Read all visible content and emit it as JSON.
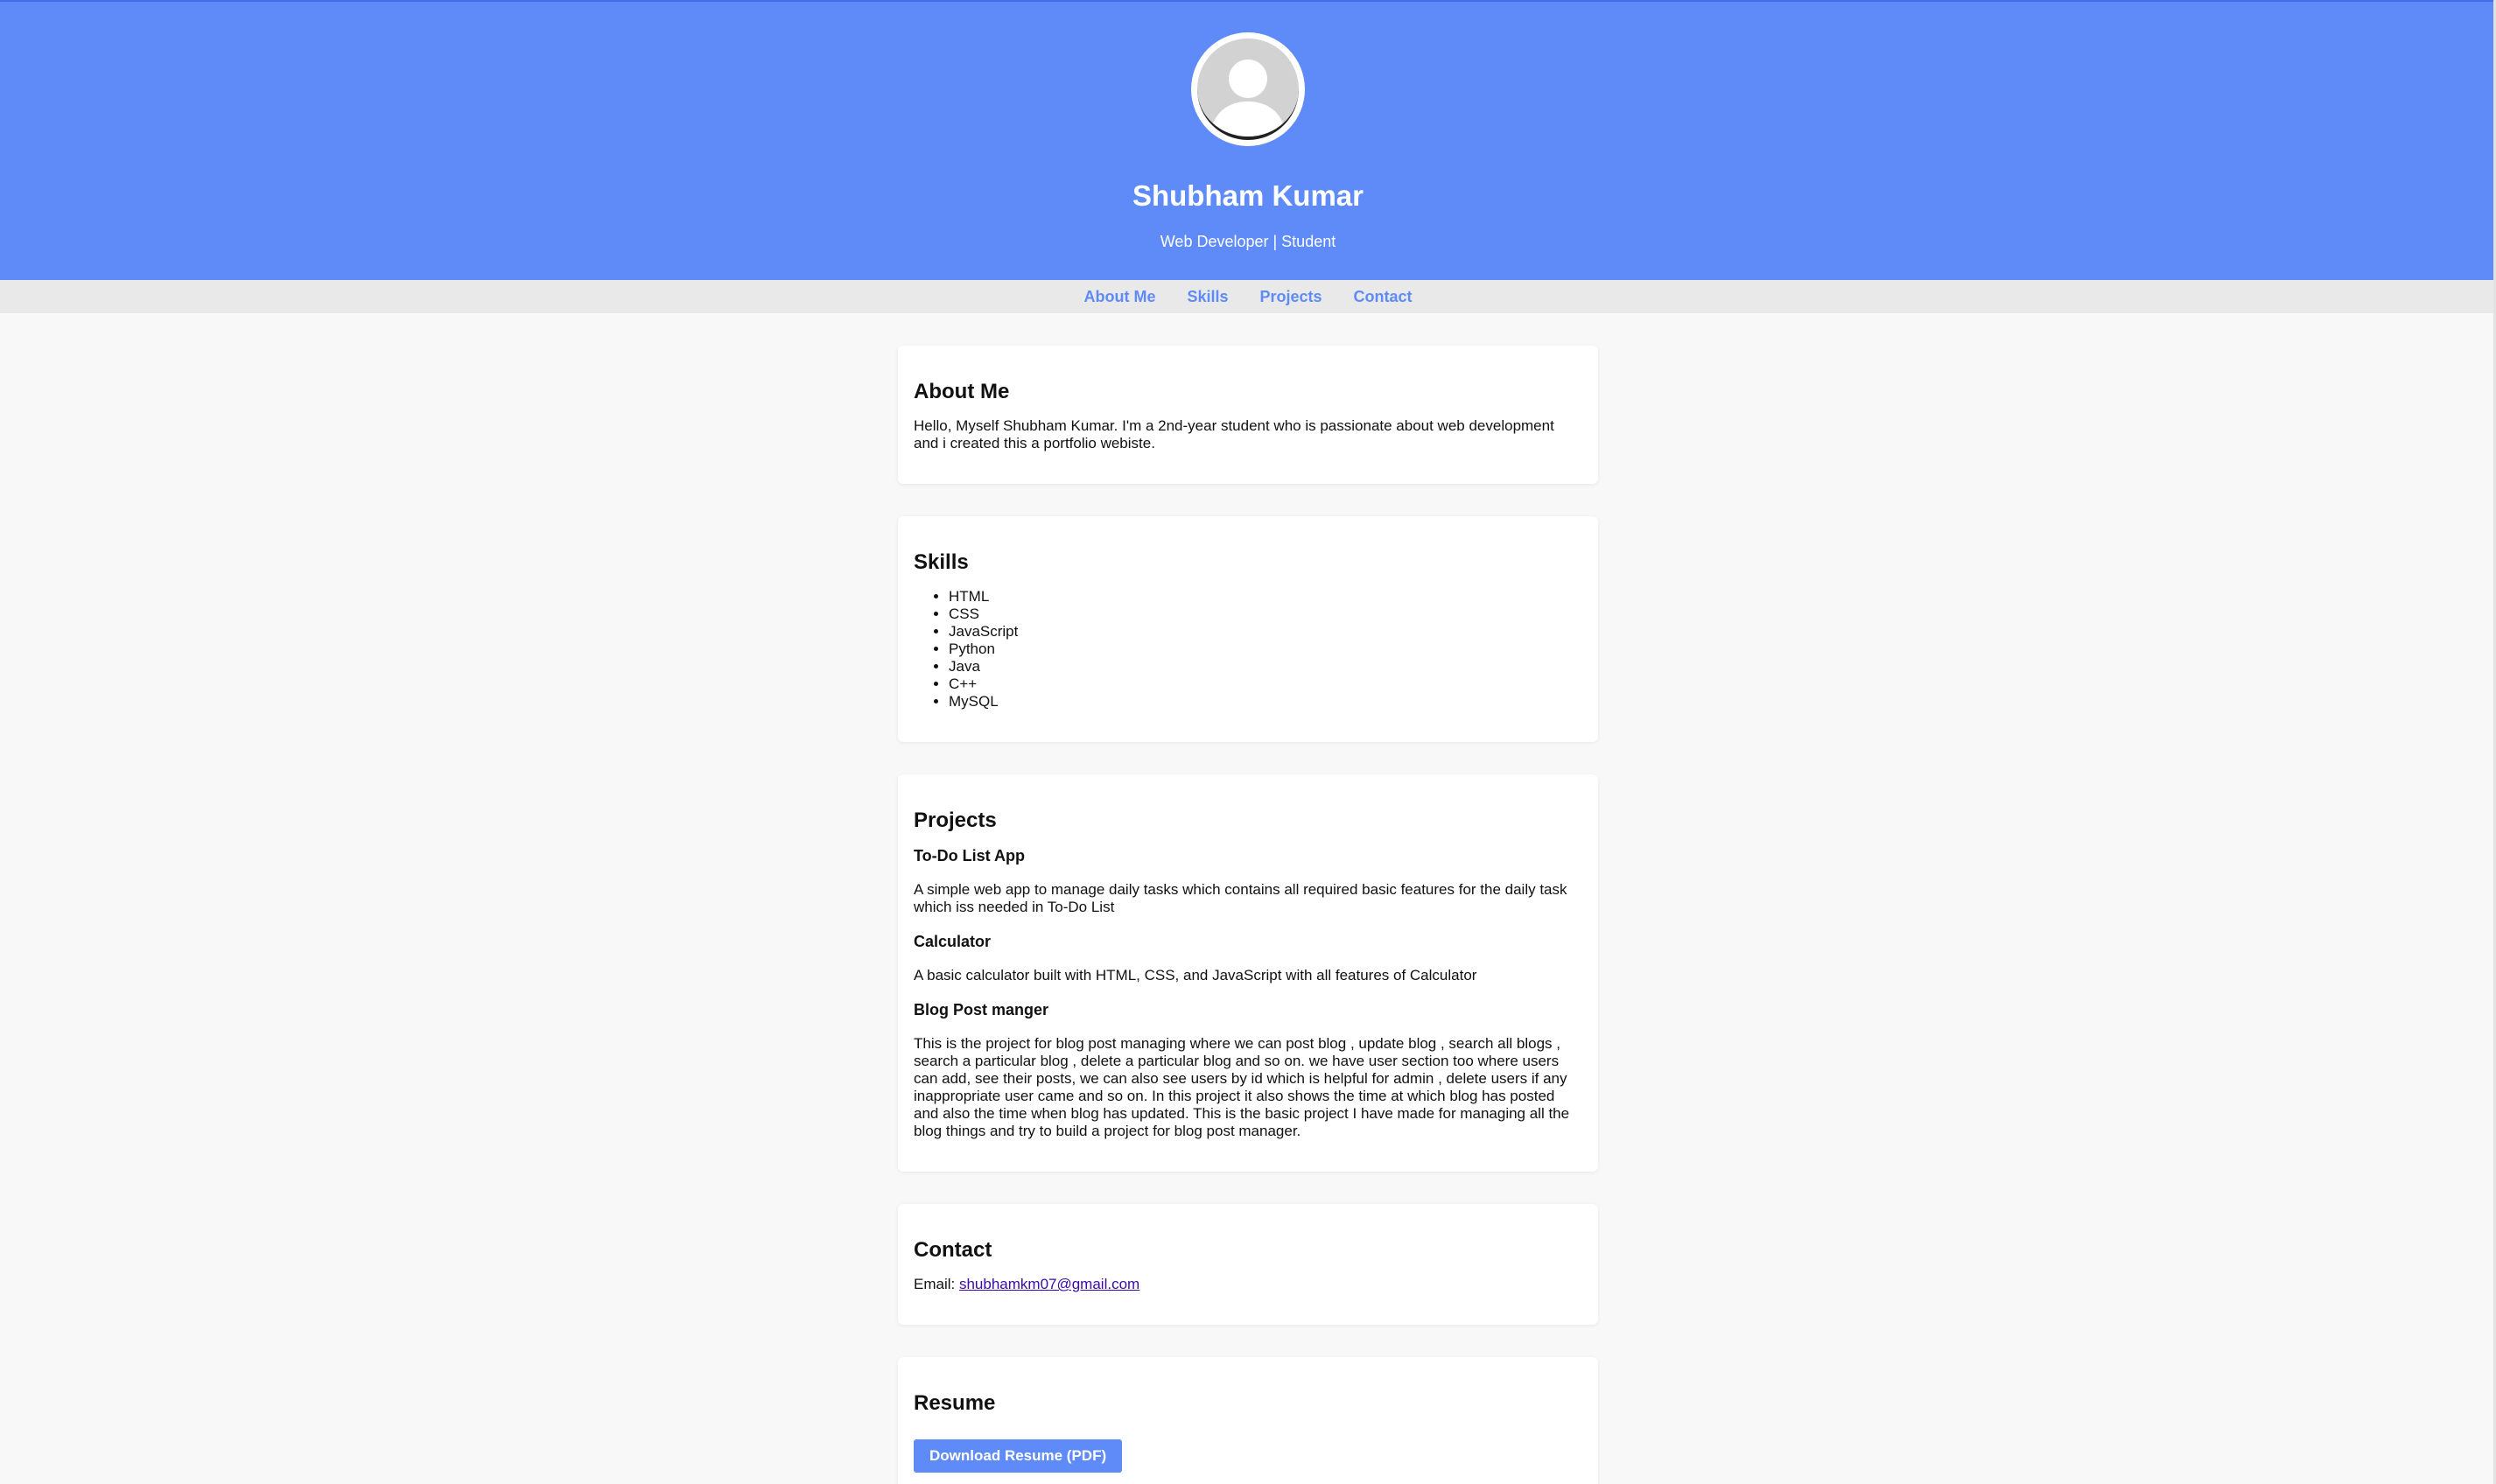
{
  "header": {
    "name": "Shubham Kumar",
    "tagline": "Web Developer | Student",
    "avatar_icon": "user-silhouette-icon",
    "background_color": "#5e8bf7"
  },
  "nav": {
    "items": [
      {
        "label": "About Me"
      },
      {
        "label": "Skills"
      },
      {
        "label": "Projects"
      },
      {
        "label": "Contact"
      }
    ],
    "link_color": "#5e8bf7"
  },
  "about": {
    "title": "About Me",
    "text": "Hello, Myself Shubham Kumar. I'm a 2nd-year student who is passionate about web development and i created this a portfolio webiste."
  },
  "skills": {
    "title": "Skills",
    "items": [
      "HTML",
      "CSS",
      "JavaScript",
      "Python",
      "Java",
      "C++",
      "MySQL"
    ]
  },
  "projects": {
    "title": "Projects",
    "items": [
      {
        "name": "To-Do List App",
        "description": "A simple web app to manage daily tasks which contains all required basic features for the daily task which iss needed in To-Do List"
      },
      {
        "name": "Calculator",
        "description": "A basic calculator built with HTML, CSS, and JavaScript with all features of Calculator"
      },
      {
        "name": "Blog Post manger",
        "description": "This is the project for blog post managing where we can post blog , update blog , search all blogs , search a particular blog , delete a particular blog and so on. we have user section too where users can add, see their posts, we can also see users by id which is helpful for admin , delete users if any inappropriate user came and so on. In this project it also shows the time at which blog has posted and also the time when blog has updated. This is the basic project I have made for managing all the blog things and try to build a project for blog post manager."
      }
    ]
  },
  "contact": {
    "title": "Contact",
    "email_label": "Email:",
    "email": "shubhamkm07@gmail.com"
  },
  "resume": {
    "title": "Resume",
    "button_label": "Download Resume (PDF)"
  }
}
